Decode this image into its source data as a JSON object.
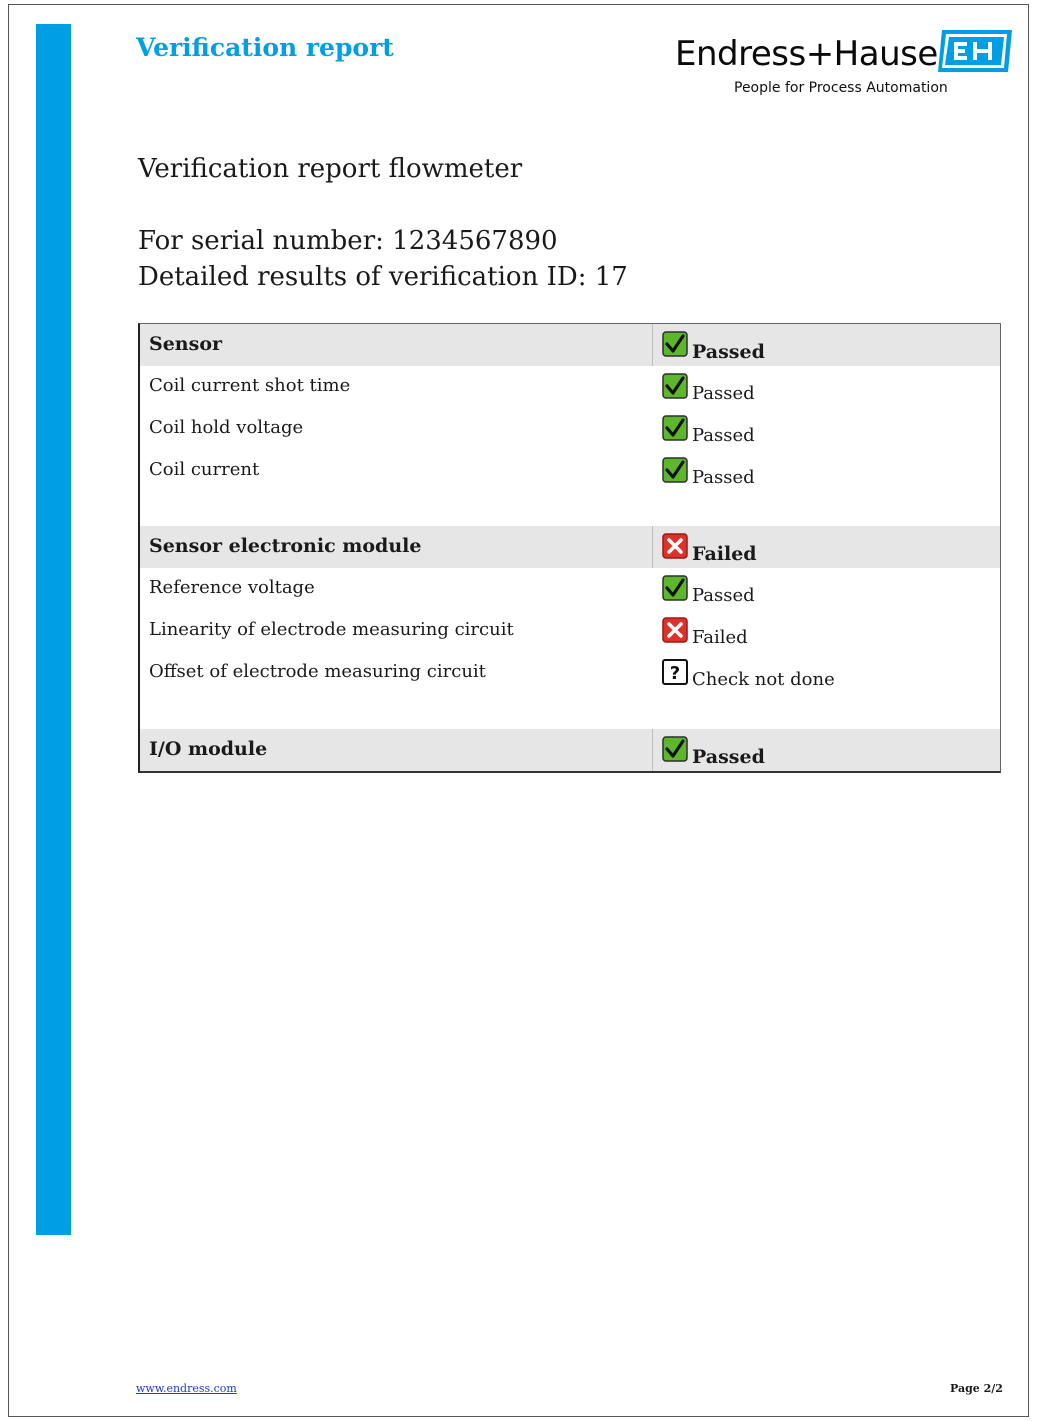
{
  "header": {
    "report_title": "Verification report",
    "brand_name": "Endress+Hauser",
    "brand_tagline": "People for Process Automation",
    "brand_color": "#009fe3"
  },
  "document": {
    "title": "Verification report flowmeter",
    "serial_line": "For serial number: 1234567890",
    "detail_line": "Detailed results of verification ID: 17"
  },
  "results": {
    "sensor": {
      "label": "Sensor",
      "status": "Passed",
      "icon": "check-icon",
      "items": [
        {
          "label": "Coil current shot time",
          "status": "Passed",
          "icon": "check-icon"
        },
        {
          "label": "Coil hold voltage",
          "status": "Passed",
          "icon": "check-icon"
        },
        {
          "label": "Coil current",
          "status": "Passed",
          "icon": "check-icon"
        }
      ]
    },
    "sensor_electronic_module": {
      "label": "Sensor electronic module",
      "status": "Failed",
      "icon": "cross-icon",
      "items": [
        {
          "label": "Reference voltage",
          "status": "Passed",
          "icon": "check-icon"
        },
        {
          "label": "Linearity of electrode measuring circuit",
          "status": "Failed",
          "icon": "cross-icon"
        },
        {
          "label": "Offset of electrode measuring circuit",
          "status": "Check not done",
          "icon": "question-icon"
        }
      ]
    },
    "io_module": {
      "label": "I/O module",
      "status": "Passed",
      "icon": "check-icon"
    }
  },
  "colors": {
    "passed": "#5cb82a",
    "failed": "#e0302a",
    "group_row": "#e6e6e6"
  },
  "footer": {
    "link": "www.endress.com",
    "page": "Page 2/2"
  }
}
